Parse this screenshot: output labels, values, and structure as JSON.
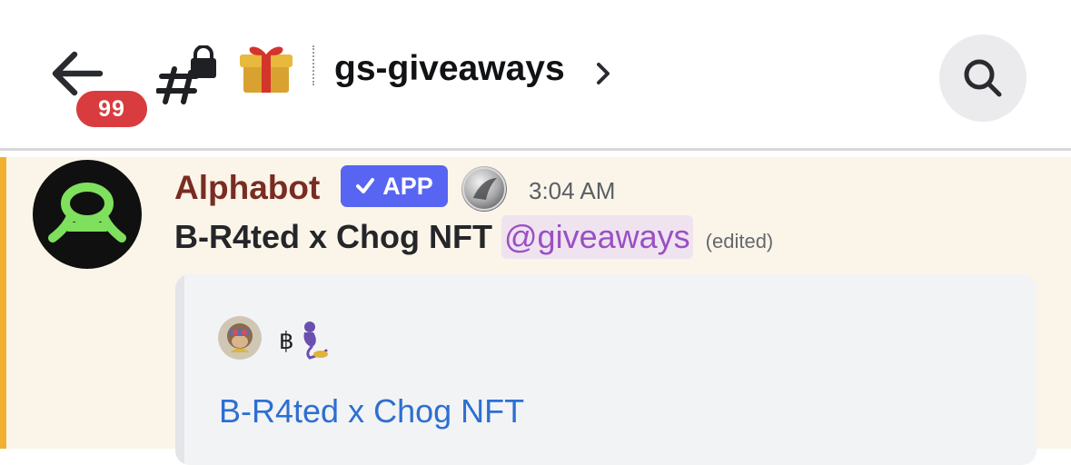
{
  "header": {
    "unread_badge": "99",
    "channel_name": "gs-giveaways"
  },
  "message": {
    "author": "Alphabot",
    "app_tag": "APP",
    "timestamp": "3:04 AM",
    "text": "B-R4ted x Chog NFT",
    "mention": "@giveaways",
    "edited": "(edited)",
    "embed": {
      "author_name": "฿",
      "title": "B-R4ted x Chog NFT"
    }
  },
  "colors": {
    "username": "#7a2c23",
    "app_tag": "#5865f2",
    "mention_text": "#9b4fc4",
    "highlight_bar": "#f0b132",
    "message_bg": "#faf5e8",
    "link": "#2d6fd1",
    "badge": "#d83c3e"
  },
  "icons": {
    "back": "arrow-left-icon",
    "channel": "locked-text-channel-icon",
    "channel_emoji": "gift-icon",
    "details": "chevron-right-icon",
    "search": "search-icon",
    "verified": "checkmark-icon"
  }
}
